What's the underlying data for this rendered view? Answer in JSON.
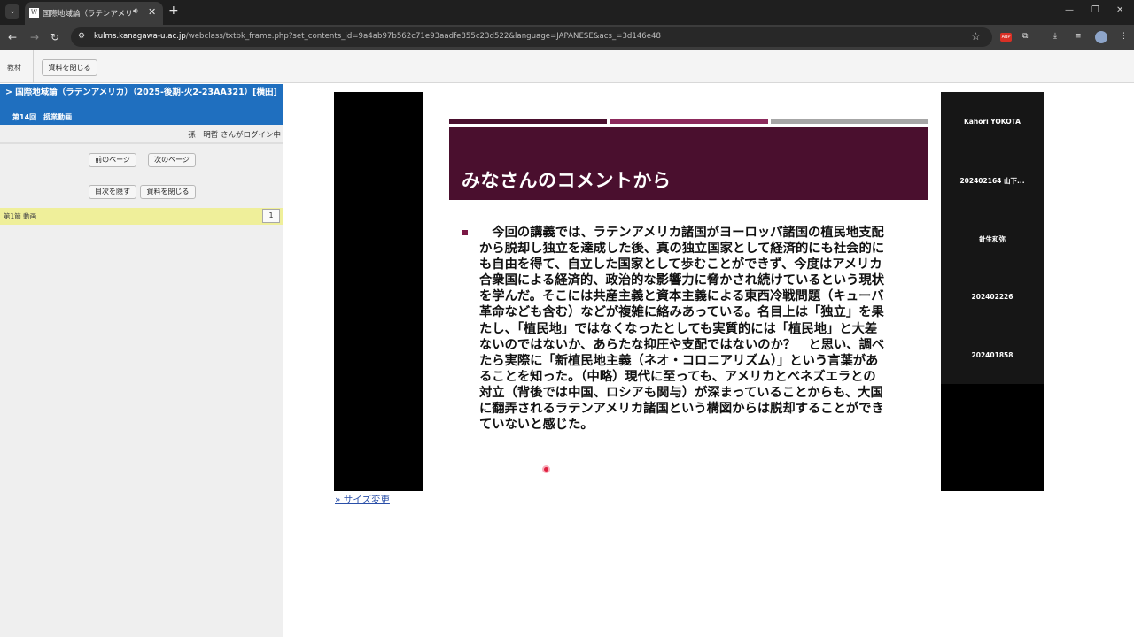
{
  "browser": {
    "tab_title": "国際地域論（ラテンアメリ",
    "favicon_letter": "W",
    "url_prefix": "",
    "url_host": "kulms.kanagawa-u.ac.jp",
    "url_rest": "/webclass/txtbk_frame.php?set_contents_id=9a4ab97b562c71e93aadfe855c23d522&language=JAPANESE&acs_=3d146e48",
    "ext_badge": "ABP",
    "icons": {
      "tab_menu": "chevron-down-icon",
      "audio": "speaker-icon",
      "close": "close-icon",
      "new_tab": "plus-icon",
      "back": "back-arrow-icon",
      "forward": "forward-arrow-icon",
      "reload": "reload-icon",
      "star": "star-icon"
    }
  },
  "top_strip": {
    "label": "教材",
    "close_button": "資料を閉じる"
  },
  "sidebar": {
    "course_title": "> 国際地域論（ラテンアメリカ）（2025-後期-火2-23AA321）[横田]",
    "session": "第14回　授業動画",
    "login_status": "孫　明哲 さんがログイン中",
    "prev_button": "前のページ",
    "next_button": "次のページ",
    "toc_button": "目次を隠す",
    "close_button": "資料を閉じる",
    "section_label": "第1節 動画",
    "section_number": "1"
  },
  "slide": {
    "title": "みなさんのコメントから",
    "body": "　今回の講義では、ラテンアメリカ諸国がヨーロッパ諸国の植民地支配\nから脱却し独立を達成した後、真の独立国家として経済的にも社会的に\nも自由を得て、自立した国家として歩むことができず、今度はアメリカ\n合衆国による経済的、政治的な影響力に脅かされ続けているという現状\nを学んだ。そこには共産主義と資本主義による東西冷戦問題（キューバ\n革命なども含む）などが複雑に絡みあっている。名目上は「独立」を果\nたし、「植民地」ではなくなったとしても実質的には「植民地」と大差\nないのではないか、あらたな抑圧や支配ではないのか？　と思い、調べ\nたら実際に「新植民地主義（ネオ・コロニアリズム）」という言葉があ\nることを知った。（中略）現代に至っても、アメリカとベネズエラとの\n対立（背後では中国、ロシアも関与）が深まっていることからも、大国\nに翻弄されるラテンアメリカ諸国という構図からは脱却することができ\nていないと感じた。",
    "stripe_colors": [
      "#4a0f2e",
      "#8c2a5c",
      "#a6a6a6"
    ]
  },
  "participants": [
    "Kahori YOKOTA",
    "202402164 山下...",
    "針生和弥",
    "202402226",
    "202401858"
  ],
  "size_link": "» サイズ変更"
}
